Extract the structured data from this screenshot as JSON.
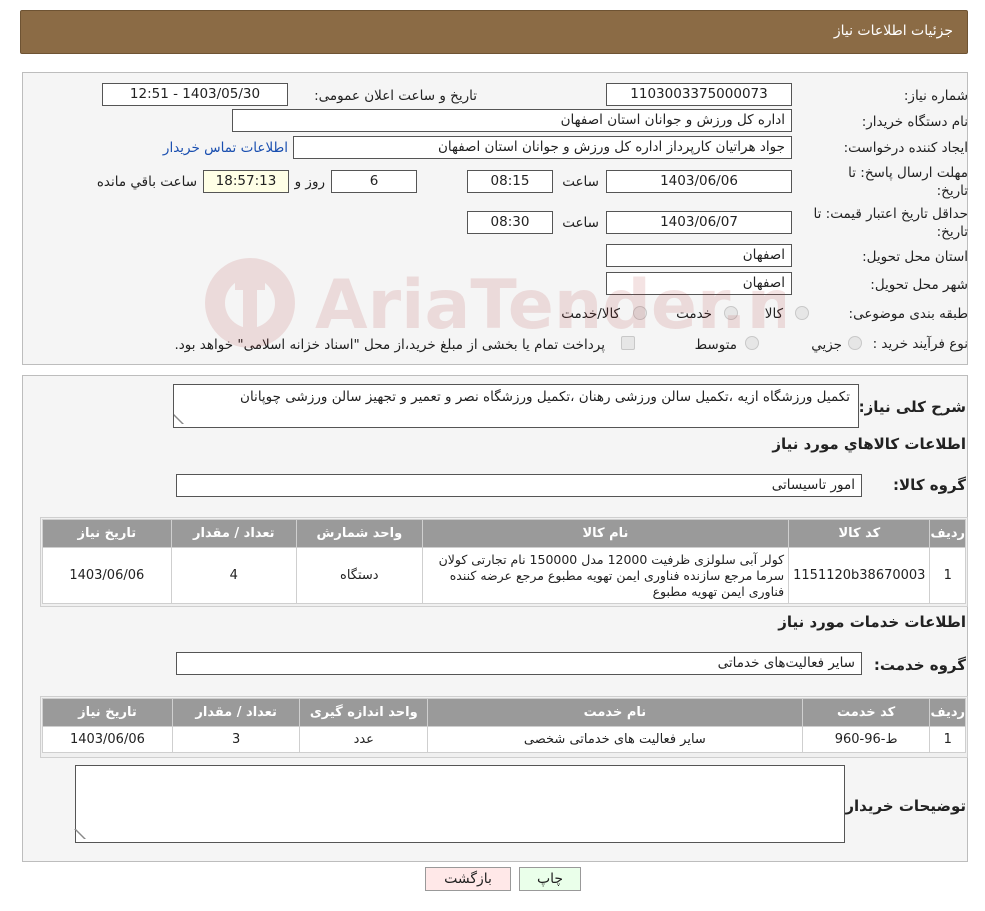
{
  "header": {
    "title": "جزئیات اطلاعات نیاز"
  },
  "info": {
    "need_number_label": "شماره نیاز:",
    "need_number": "1103003375000073",
    "announce_label": "تاریخ و ساعت اعلان عمومی:",
    "announce_value": "1403/05/30 - 12:51",
    "buyer_org_label": "نام دستگاه خریدار:",
    "buyer_org": "اداره کل ورزش و جوانان استان اصفهان",
    "creator_label": "ایجاد کننده درخواست:",
    "creator": "جواد هراتیان کارپرداز اداره کل ورزش و جوانان استان اصفهان",
    "contact_link": "اطلاعات تماس خریدار",
    "reply_deadline_label_1": "مهلت ارسال پاسخ: تا",
    "reply_deadline_label_2": "تاریخ:",
    "reply_date": "1403/06/06",
    "time_label": "ساعت",
    "reply_time": "08:15",
    "days_count": "6",
    "days_label": "روز و",
    "remaining_time": "18:57:13",
    "remaining_label": "ساعت باقي مانده",
    "price_validity_label_1": "حداقل تاریخ اعتبار قیمت: تا",
    "price_validity_label_2": "تاریخ:",
    "price_validity_date": "1403/06/07",
    "price_validity_time": "08:30",
    "delivery_province_label": "استان محل تحویل:",
    "delivery_province": "اصفهان",
    "delivery_city_label": "شهر محل تحویل:",
    "delivery_city": "اصفهان",
    "category_label": "طبقه بندی موضوعی:",
    "category_options": [
      "کالا",
      "خدمت",
      "کالا/خدمت"
    ],
    "purchase_type_label": "نوع فرآیند خرید :",
    "purchase_type_options": [
      "جزیي",
      "متوسط"
    ],
    "payment_note": "پرداخت تمام یا بخشی از مبلغ خرید،از محل \"اسناد خزانه اسلامی\" خواهد بود."
  },
  "details": {
    "description_label": "شرح کلی نیاز:",
    "description": "تکمیل ورزشگاه ازیه ،تکمیل سالن ورزشی رهنان ،تکمیل ورزشگاه نصر و تعمیر و تجهیز سالن ورزشی چوپانان",
    "goods_section_title": "اطلاعات کالاهاي مورد نياز",
    "goods_group_label": "گروه کالا:",
    "goods_group": "امور تاسیساتی",
    "goods_table": {
      "headers": [
        "ردیف",
        "کد کالا",
        "نام کالا",
        "واحد شمارش",
        "تعداد / مقدار",
        "تاریخ نیاز"
      ],
      "rows": [
        [
          "1",
          "1151120b38670003",
          "کولر آبی سلولزی ظرفیت 12000 مدل 150000 نام تجارتی کولان سرما مرجع سازنده فناوری ایمن تهویه مطبوع مرجع عرضه کننده فناوری ایمن تهویه مطبوع",
          "دستگاه",
          "4",
          "1403/06/06"
        ]
      ]
    },
    "services_section_title": "اطلاعات خدمات مورد نیاز",
    "service_group_label": "گروه خدمت:",
    "service_group": "سایر فعالیت‌های خدماتی",
    "services_table": {
      "headers": [
        "ردیف",
        "کد خدمت",
        "نام خدمت",
        "واحد اندازه گیری",
        "تعداد / مقدار",
        "تاریخ نیاز"
      ],
      "rows": [
        [
          "1",
          "ط-96-960",
          "سایر فعالیت های خدماتی شخصی",
          "عدد",
          "3",
          "1403/06/06"
        ]
      ]
    },
    "buyer_notes_label": "توضیحات خریدار:",
    "buyer_notes": ""
  },
  "buttons": {
    "print": "چاپ",
    "back": "بازگشت"
  },
  "watermark": {
    "text": "AriaTender.neT",
    "color": "#b03030"
  },
  "colors": {
    "header_bg": "#8b6b45",
    "table_header_bg": "#9a9a9a",
    "link": "#1a4fb0"
  }
}
